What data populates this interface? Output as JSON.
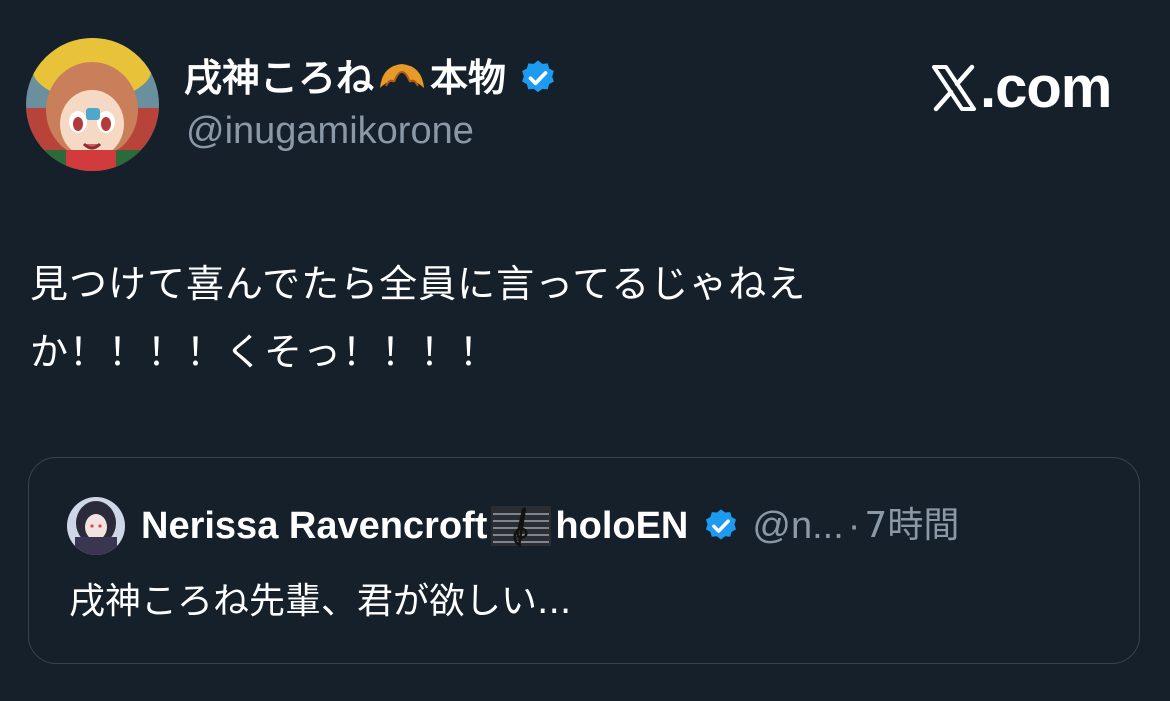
{
  "author": {
    "display_name": "戌神ころね",
    "display_name_suffix": "本物",
    "name_emoji": "croissant-icon",
    "verified_icon": "verified-badge-icon",
    "handle": "@inugamikorone"
  },
  "brand": {
    "text": ".com",
    "icon": "x-logo-icon"
  },
  "tweet": {
    "lines": [
      "見つけて喜んでたら全員に言ってるじゃねえ",
      "か！！！！くそっ！！！！"
    ]
  },
  "quoted": {
    "display_name": "Nerissa Ravencroft",
    "name_emoji": "music-staff-icon",
    "display_name_suffix": "holoEN",
    "handle": "@n...",
    "separator": "·",
    "time": "7時間",
    "text": "戌神ころね先輩、君が欲しい..."
  },
  "colors": {
    "background": "#15202b",
    "text": "#ffffff",
    "secondary_text": "#8b98a5",
    "border": "#38444d",
    "verified": "#1d9bf0"
  }
}
